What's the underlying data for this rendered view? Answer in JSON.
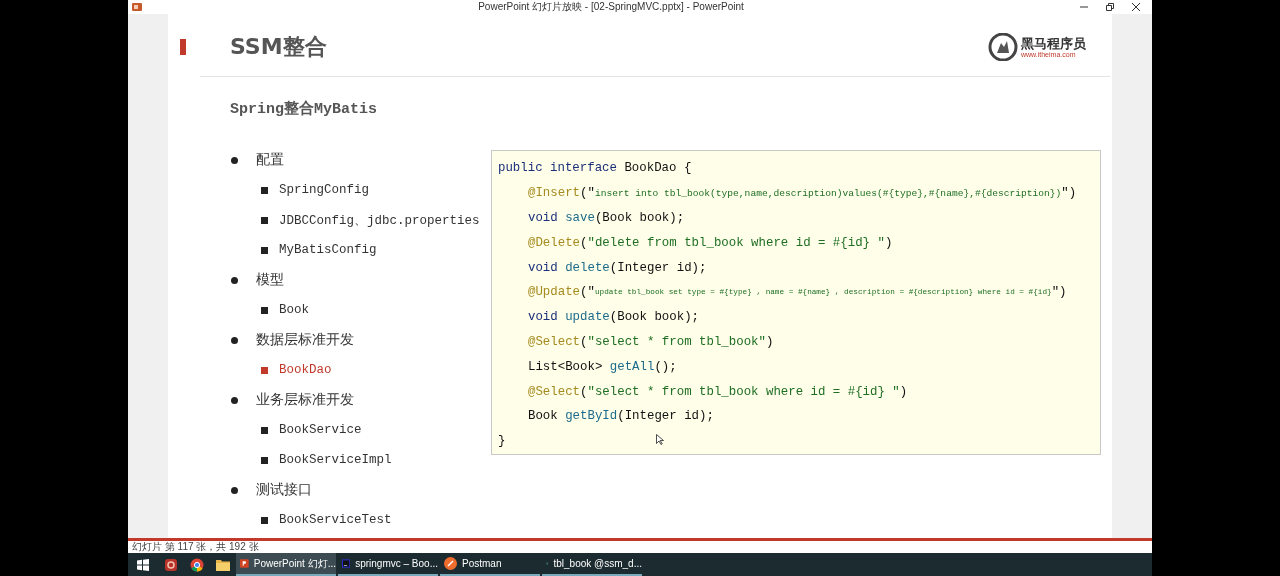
{
  "window": {
    "title": "PowerPoint 幻灯片放映 - [02-SpringMVC.pptx] - PowerPoint"
  },
  "slide": {
    "title": "SSM整合",
    "logo": {
      "name": "黑马程序员",
      "url": "www.itheima.com"
    },
    "subtitle": "Spring整合MyBatis",
    "outline": [
      {
        "text": "配置",
        "children": [
          {
            "text": "SpringConfig",
            "selected": false
          },
          {
            "text": "JDBCConfig、jdbc.properties",
            "selected": false
          },
          {
            "text": "MyBatisConfig",
            "selected": false
          }
        ]
      },
      {
        "text": "模型",
        "children": [
          {
            "text": "Book",
            "selected": false
          }
        ]
      },
      {
        "text": "数据层标准开发",
        "children": [
          {
            "text": "BookDao",
            "selected": true
          }
        ]
      },
      {
        "text": "业务层标准开发",
        "children": [
          {
            "text": "BookService",
            "selected": false
          },
          {
            "text": "BookServiceImpl",
            "selected": false
          }
        ]
      },
      {
        "text": "测试接口",
        "children": [
          {
            "text": "BookServiceTest",
            "selected": false
          }
        ]
      }
    ],
    "code": [
      {
        "kind": "outer",
        "tokens": [
          {
            "kind": "keyword",
            "text": "public interface"
          },
          {
            "kind": "plain",
            "text": " BookDao {"
          }
        ]
      },
      {
        "kind": "inner",
        "tokens": [
          {
            "kind": "annotation",
            "text": "@Insert"
          },
          {
            "kind": "plain",
            "text": "(\""
          },
          {
            "kind": "string-small",
            "text": "insert into tbl_book(type,name,description)values(#{type},#{name},#{description})"
          },
          {
            "kind": "plain",
            "text": "\")"
          }
        ]
      },
      {
        "kind": "inner",
        "tokens": [
          {
            "kind": "keyword",
            "text": "void "
          },
          {
            "kind": "method",
            "text": "save"
          },
          {
            "kind": "plain",
            "text": "(Book book);"
          }
        ]
      },
      {
        "kind": "inner",
        "tokens": [
          {
            "kind": "annotation",
            "text": "@Delete"
          },
          {
            "kind": "plain",
            "text": "("
          },
          {
            "kind": "string",
            "text": "\"delete from tbl_book where id = #{id} \""
          },
          {
            "kind": "plain",
            "text": ")"
          }
        ]
      },
      {
        "kind": "inner",
        "tokens": [
          {
            "kind": "keyword",
            "text": "void "
          },
          {
            "kind": "method",
            "text": "delete"
          },
          {
            "kind": "plain",
            "text": "(Integer id);"
          }
        ]
      },
      {
        "kind": "inner",
        "tokens": [
          {
            "kind": "annotation",
            "text": "@Update"
          },
          {
            "kind": "plain",
            "text": "(\""
          },
          {
            "kind": "string-tiny",
            "text": "update tbl_book set type = #{type} , name = #{name} , description = #{description} where id = #{id}"
          },
          {
            "kind": "plain",
            "text": "\")"
          }
        ]
      },
      {
        "kind": "inner",
        "tokens": [
          {
            "kind": "keyword",
            "text": "void "
          },
          {
            "kind": "method",
            "text": "update"
          },
          {
            "kind": "plain",
            "text": "(Book book);"
          }
        ]
      },
      {
        "kind": "inner",
        "tokens": [
          {
            "kind": "annotation",
            "text": "@Select"
          },
          {
            "kind": "plain",
            "text": "("
          },
          {
            "kind": "string",
            "text": "\"select * from tbl_book\""
          },
          {
            "kind": "plain",
            "text": ")"
          }
        ]
      },
      {
        "kind": "inner",
        "tokens": [
          {
            "kind": "plain",
            "text": "List<Book> "
          },
          {
            "kind": "method",
            "text": "getAll"
          },
          {
            "kind": "plain",
            "text": "();"
          }
        ]
      },
      {
        "kind": "inner",
        "tokens": [
          {
            "kind": "annotation",
            "text": "@Select"
          },
          {
            "kind": "plain",
            "text": "("
          },
          {
            "kind": "string",
            "text": "\"select * from tbl_book where id = #{id} \""
          },
          {
            "kind": "plain",
            "text": ")"
          }
        ]
      },
      {
        "kind": "inner",
        "tokens": [
          {
            "kind": "plain",
            "text": "Book "
          },
          {
            "kind": "method",
            "text": "getById"
          },
          {
            "kind": "plain",
            "text": "(Integer id);"
          }
        ]
      },
      {
        "kind": "outer",
        "tokens": [
          {
            "kind": "plain",
            "text": "}"
          }
        ]
      }
    ]
  },
  "status_bar": {
    "text": "幻灯片 第 117 张，共 192 张"
  },
  "taskbar": {
    "items": [
      {
        "kind": "start"
      },
      {
        "kind": "app-red"
      },
      {
        "kind": "chrome"
      },
      {
        "kind": "folder"
      },
      {
        "kind": "presentation",
        "label": "PowerPoint 幻灯...",
        "selected": true
      },
      {
        "kind": "ide",
        "label": "springmvc – Boo...",
        "selected": false
      },
      {
        "kind": "postman",
        "label": "Postman",
        "selected": false
      },
      {
        "kind": "database",
        "label": "tbl_book @ssm_d...",
        "selected": false
      }
    ]
  }
}
